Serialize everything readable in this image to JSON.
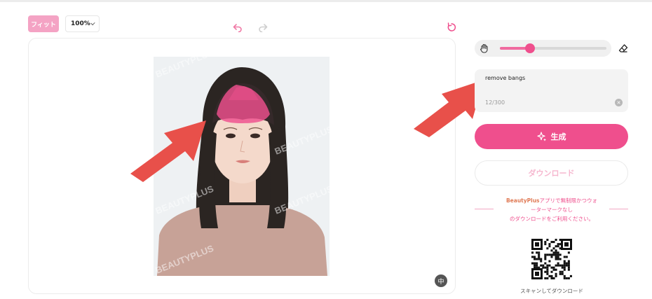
{
  "toolbar": {
    "fit_label": "フィット",
    "zoom_value": "100%"
  },
  "canvas": {
    "compare_glyph": "中",
    "watermark": "BEAUTYPLUS",
    "brush_mask_color": "#ef4f8d"
  },
  "brush": {
    "size_fraction": 0.28
  },
  "prompt": {
    "value": "remove bangs",
    "count": "12/300"
  },
  "actions": {
    "generate_label": "生成",
    "download_label": "ダウンロード"
  },
  "promo": {
    "brand": "BeautyPlus",
    "line1_rest": "アプリで無制限かつウォ",
    "line2": "ーターマークなし",
    "line3": "のダウンロードをご利用ください。"
  },
  "qr_caption": "スキャンしてダウンロード",
  "colors": {
    "accent": "#ef4f8d",
    "accent_light": "#f4a3c4",
    "arrow": "#e8504a"
  },
  "icons": [
    "undo-icon",
    "redo-icon",
    "reset-icon",
    "hand-icon",
    "eraser-icon",
    "sparkle-icon",
    "clear-icon",
    "compare-icon",
    "qr-code"
  ]
}
